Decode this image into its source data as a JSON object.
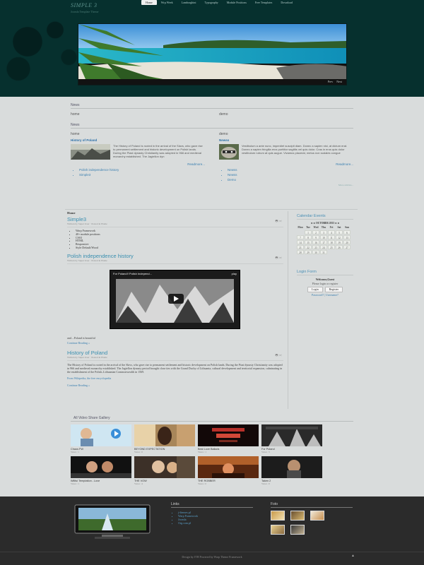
{
  "header": {
    "logo": "SIMPLE 3",
    "tagline": "Joomla Template Theme",
    "nav": [
      "Home",
      "Wrp Week",
      "Lamborghini",
      "Typography",
      "Module Positions",
      "Free Templates",
      "Download"
    ],
    "slider_nav": [
      "Prev",
      "Next"
    ]
  },
  "topmods": {
    "news_head": "News",
    "left_label": "home",
    "right_label": "demo",
    "left_article": {
      "title": "History of Poland",
      "text": "The History of Poland is rooted in the arrival of the Slavs, who gave rise to permanent settlement and historic development on Polish lands. During the Piast dynasty Christianity was adopted in 966 and medieval monarchy established. The Jagiellon dyn",
      "readmore": "Readmore..."
    },
    "right_article": {
      "title": "Newss",
      "text": "Vestibulum a ante nunc, imperdiet suscipit diam. Donec a sapien nisi, at dictum erat. Donec a sapien fringilla eros porttitor sagittis vel quis dolor. Cras in eros quis dolor vestibulum rutrum at quis augue. Vivamus placerat, metus non sodales congue",
      "readmore": "Readmore..."
    },
    "left_links": [
      "Polish independence history",
      "Simple3"
    ],
    "right_links": [
      "Newss",
      "Newss",
      "Demo"
    ],
    "more_label": "More articles..."
  },
  "main": {
    "home_label": "Home",
    "posts": [
      {
        "title": "Simple3",
        "meta": "Written by Super User · Posted in Home",
        "items": [
          "Warp Framework",
          "40+ module positions",
          "CSS3",
          "HTML",
          "Responsive",
          "Style Default/Wood"
        ]
      },
      {
        "title": "Polish independence history",
        "meta": "Written by Super User · Posted in Home",
        "video_title": "For Poland!! Polish Independ...",
        "video_meta": "play",
        "text": "and....Poland is beautiful",
        "continue": "Continue Reading »"
      },
      {
        "title": "History of Poland",
        "meta": "Written by Super User · Posted in Home",
        "text": "The History of Poland is rooted in the arrival of the Slavs, who gave rise to permanent settlement and historic development on Polish lands. During the Piast dynasty Christianity was adopted in 966 and medieval monarchy established. The Jagiellon dynasty period brought close ties with the Grand Duchy of Lithuania, cultural development and territorial expansion, culminating in the establishment of the Polish–Lithuanian Commonwealth in 1569.",
        "source": "From Wikipedia, the free encyclopedia",
        "continue": "Continue Reading »"
      }
    ]
  },
  "sidebar": {
    "calendar_head": "Calendar Events",
    "month": "◄◄ OCTOBER 2013 ►►",
    "days": [
      "Mon",
      "Tue",
      "Wed",
      "Thu",
      "Fri",
      "Sat",
      "Sun"
    ],
    "dates": [
      "",
      "1",
      "2",
      "3",
      "4",
      "5",
      "6",
      "7",
      "8",
      "9",
      "10",
      "11",
      "12",
      "13",
      "14",
      "15",
      "16",
      "17",
      "18",
      "19",
      "20",
      "21",
      "22",
      "23",
      "24",
      "25",
      "26",
      "27",
      "28",
      "29",
      "30",
      "31",
      "",
      "",
      ""
    ],
    "login_head": "Login Form",
    "welcome": "Welcome,Guest",
    "please": "Please login or register",
    "login_btn": "Login",
    "register_btn": "Register",
    "forgot": "Password? | Username?"
  },
  "gallery": {
    "head": "All Video Share Gallery",
    "items": [
      {
        "caption": "Chaos FW",
        "views": "Views : 1"
      },
      {
        "caption": "BEYOND EXPECTATION",
        "views": "Views : 0"
      },
      {
        "caption": "Best Love Ballads",
        "views": "Views : 1"
      },
      {
        "caption": "For Poland",
        "views": "Views : 5"
      },
      {
        "caption": "Willful Temptation - Love",
        "views": "Views : 1"
      },
      {
        "caption": "THE VOW",
        "views": "Views : 4"
      },
      {
        "caption": "THE ROBBER",
        "views": "Views : 0"
      },
      {
        "caption": "Taken 2",
        "views": "Views : 0"
      }
    ]
  },
  "footer": {
    "links_head": "Links",
    "links": [
      "j-themes.pl",
      "Warp Framework",
      "Joomla",
      "Org.com.pl"
    ],
    "photos_head": "Foto",
    "copyright": "Design by JTH Powered by Warp Theme Framework",
    "totop": "▲"
  }
}
